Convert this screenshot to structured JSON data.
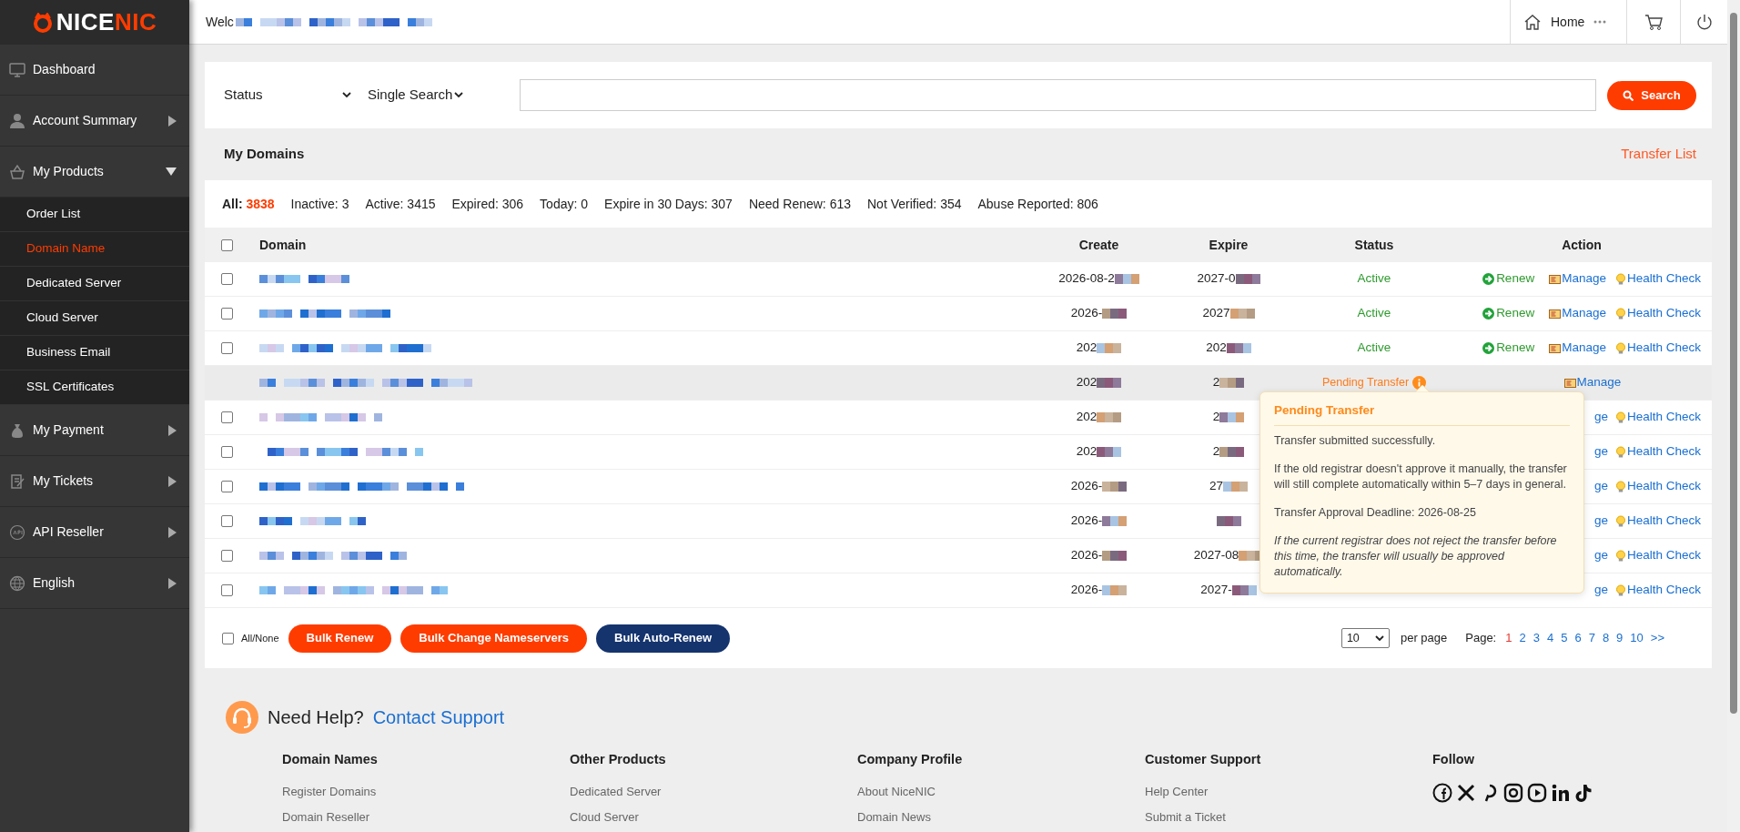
{
  "header": {
    "welcome": "Welc",
    "home": "Home"
  },
  "sidebar": {
    "logo": [
      "NICE",
      "NIC"
    ],
    "items": [
      {
        "label": "Dashboard"
      },
      {
        "label": "Account Summary",
        "expanded": false
      },
      {
        "label": "My Products",
        "expanded": true,
        "children": [
          {
            "label": "Order List",
            "selected": false
          },
          {
            "label": "Domain Name",
            "selected": true
          },
          {
            "label": "Dedicated Server",
            "selected": false
          },
          {
            "label": "Cloud Server",
            "selected": false
          },
          {
            "label": "Business Email",
            "selected": false
          },
          {
            "label": "SSL Certificates",
            "selected": false
          }
        ]
      },
      {
        "label": "My Payment",
        "expanded": false
      },
      {
        "label": "My Tickets",
        "expanded": false
      },
      {
        "label": "API Reseller",
        "expanded": false
      },
      {
        "label": "English",
        "expanded": false
      }
    ]
  },
  "filters": {
    "status_select": "Status",
    "mode_select": "Single Search",
    "search_button": "Search"
  },
  "section": {
    "title": "My Domains",
    "transfer_link": "Transfer List"
  },
  "stats": [
    {
      "label": "All:",
      "value": "3838",
      "selected": true
    },
    {
      "label": "Inactive:",
      "value": "3",
      "selected": false
    },
    {
      "label": "Active:",
      "value": "3415",
      "selected": false
    },
    {
      "label": "Expired:",
      "value": "306",
      "selected": false
    },
    {
      "label": "Today:",
      "value": "0",
      "selected": false
    },
    {
      "label": "Expire in 30 Days:",
      "value": "307",
      "selected": false
    },
    {
      "label": "Need Renew:",
      "value": "613",
      "selected": false
    },
    {
      "label": "Not Verified:",
      "value": "354",
      "selected": false
    },
    {
      "label": "Abuse Reported:",
      "value": "806",
      "selected": false
    }
  ],
  "table": {
    "columns": [
      "Domain",
      "Create",
      "Expire",
      "Status",
      "Action"
    ],
    "rows": [
      {
        "checked": false,
        "hovered": false,
        "create": "2026-08-2",
        "expire": "2027-0",
        "status": {
          "kind": "active",
          "label": "Active"
        },
        "actions": [
          {
            "kind": "renew",
            "label": "Renew"
          },
          {
            "kind": "manage",
            "label": "Manage"
          },
          {
            "kind": "health",
            "label": "Health Check"
          }
        ]
      },
      {
        "checked": false,
        "hovered": false,
        "create": "2026-",
        "expire": "2027",
        "status": {
          "kind": "active",
          "label": "Active"
        },
        "actions": [
          {
            "kind": "renew",
            "label": "Renew"
          },
          {
            "kind": "manage",
            "label": "Manage"
          },
          {
            "kind": "health",
            "label": "Health Check"
          }
        ]
      },
      {
        "checked": false,
        "hovered": false,
        "create": "202",
        "expire": "202",
        "status": {
          "kind": "active",
          "label": "Active"
        },
        "actions": [
          {
            "kind": "renew",
            "label": "Renew"
          },
          {
            "kind": "manage",
            "label": "Manage"
          },
          {
            "kind": "health",
            "label": "Health Check"
          }
        ]
      },
      {
        "hovered": true,
        "create": "202",
        "expire": "2",
        "status": {
          "kind": "pending",
          "label": "Pending Transfer"
        },
        "actions": [
          {
            "kind": "manage",
            "label": "Manage"
          }
        ]
      },
      {
        "checked": false,
        "hovered": false,
        "create": "202",
        "expire": "2",
        "actions": [
          {
            "kind": "partial",
            "label": "ge"
          },
          {
            "kind": "health",
            "label": "Health Check"
          }
        ]
      },
      {
        "checked": false,
        "hovered": false,
        "create": "202",
        "expire": "2",
        "actions": [
          {
            "kind": "partial",
            "label": "ge"
          },
          {
            "kind": "health",
            "label": "Health Check"
          }
        ]
      },
      {
        "checked": false,
        "hovered": false,
        "create": "2026-",
        "expire": "27",
        "actions": [
          {
            "kind": "partial",
            "label": "ge"
          },
          {
            "kind": "health",
            "label": "Health Check"
          }
        ]
      },
      {
        "checked": false,
        "hovered": false,
        "create": "2026-",
        "actions": [
          {
            "kind": "partial",
            "label": "ge"
          },
          {
            "kind": "health",
            "label": "Health Check"
          }
        ]
      },
      {
        "checked": false,
        "hovered": false,
        "create": "2026-",
        "expire": "2027-08",
        "actions": [
          {
            "kind": "partial",
            "label": "ge"
          },
          {
            "kind": "health",
            "label": "Health Check"
          }
        ]
      },
      {
        "checked": false,
        "hovered": false,
        "create": "2026-",
        "expire": "2027-",
        "actions": [
          {
            "kind": "partial",
            "label": "ge"
          },
          {
            "kind": "health",
            "label": "Health Check"
          }
        ]
      }
    ]
  },
  "tooltip": {
    "title": "Pending Transfer",
    "paragraphs": [
      {
        "kind": "plain",
        "text": "Transfer submitted successfully."
      },
      {
        "kind": "plain",
        "text": "If the old registrar doesn't approve it manually, the transfer will still complete automatically within 5–7 days in general."
      },
      {
        "kind": "plain",
        "text": "Transfer Approval Deadline: 2026-08-25"
      },
      {
        "kind": "note",
        "text": "If the current registrar does not reject the transfer before this time, the transfer will usually be approved automatically."
      }
    ]
  },
  "bulk": {
    "all_none": "All/None",
    "checked": false,
    "buttons": [
      {
        "label": "Bulk Renew",
        "kind": "primary"
      },
      {
        "label": "Bulk Change Nameservers",
        "kind": "primary"
      },
      {
        "label": "Bulk Auto-Renew",
        "kind": "secondary"
      }
    ]
  },
  "pagination": {
    "per_page_value": "10",
    "per_page_label": "per page",
    "page_label": "Page:",
    "pages": [
      {
        "label": "1",
        "selected": true
      },
      {
        "label": "2",
        "selected": false
      },
      {
        "label": "3",
        "selected": false
      },
      {
        "label": "4",
        "selected": false
      },
      {
        "label": "5",
        "selected": false
      },
      {
        "label": "6",
        "selected": false
      },
      {
        "label": "7",
        "selected": false
      },
      {
        "label": "8",
        "selected": false
      },
      {
        "label": "9",
        "selected": false
      },
      {
        "label": "10",
        "selected": false
      },
      {
        "label": ">>",
        "selected": false
      }
    ]
  },
  "footer": {
    "help": "Need Help?",
    "contact": "Contact Support",
    "columns": [
      {
        "kind": "links",
        "title": "Domain Names",
        "links": [
          "Register Domains",
          "Domain Reseller"
        ]
      },
      {
        "kind": "links",
        "title": "Other Products",
        "links": [
          "Dedicated Server",
          "Cloud Server"
        ]
      },
      {
        "kind": "links",
        "title": "Company Profile",
        "links": [
          "About NiceNIC",
          "Domain News"
        ]
      },
      {
        "kind": "links",
        "title": "Customer Support",
        "links": [
          "Help Center",
          "Submit a Ticket"
        ]
      },
      {
        "kind": "social",
        "title": "Follow"
      }
    ]
  }
}
